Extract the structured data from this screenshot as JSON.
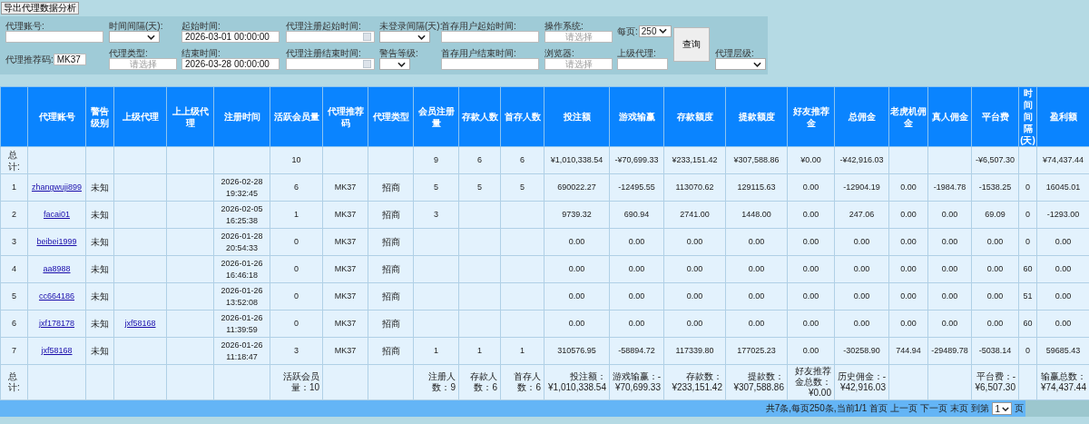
{
  "export_button": "导出代理数据分析",
  "filter_rows": [
    [
      {
        "label": "代理账号:",
        "kind": "text",
        "label_inline": false
      },
      {
        "label": "时间间隔(天):",
        "kind": "select",
        "label_inline": false
      },
      {
        "label": "起始时间:",
        "kind": "text",
        "value": "2026-03-01 00:00:00",
        "label_inline": false
      },
      {
        "label": "代理注册起始时间:",
        "kind": "date",
        "label_inline": false
      },
      {
        "label": "未登录间隔(天):",
        "kind": "select",
        "label_inline": false
      },
      {
        "label": "首存用户起始时间:",
        "kind": "text",
        "label_inline": false
      },
      {
        "label": "操作系统:",
        "kind": "text",
        "placeholder": "请选择",
        "label_inline": false
      },
      {
        "label": "每页:",
        "kind": "select",
        "value": "250",
        "label_inline": true
      }
    ],
    [
      {
        "label": "代理推荐码:",
        "kind": "text",
        "value": "MK37",
        "label_inline": true
      },
      {
        "label": "代理类型:",
        "kind": "text",
        "placeholder": "请选择",
        "label_inline": false
      },
      {
        "label": "结束时间:",
        "kind": "text",
        "value": "2026-03-28 00:00:00",
        "label_inline": false
      },
      {
        "label": "代理注册结束时间:",
        "kind": "date",
        "label_inline": false
      },
      {
        "label": "警告等级:",
        "kind": "select",
        "label_inline": false
      },
      {
        "label": "首存用户结束时间:",
        "kind": "text",
        "label_inline": false
      },
      {
        "label": "浏览器:",
        "kind": "text",
        "placeholder": "请选择",
        "label_inline": false
      },
      {
        "label": "上级代理:",
        "kind": "text",
        "label_inline": false
      },
      {
        "label": "代理层级:",
        "kind": "select",
        "label_inline": false
      }
    ]
  ],
  "query_button": "查询",
  "table": {
    "columns": [
      "代理账号",
      "警告级别",
      "上级代理",
      "上上级代理",
      "注册时间",
      "活跃会员量",
      "代理推荐码",
      "代理类型",
      "会员注册量",
      "存款人数",
      "首存人数",
      "投注额",
      "游戏输赢",
      "存款额度",
      "提款额度",
      "好友推荐金",
      "总佣金",
      "老虎机佣金",
      "真人佣金",
      "平台费",
      "时间间隔(天)",
      "盈利额"
    ],
    "total_top": {
      "label": "总计:",
      "active_members": "10",
      "member_registrations": "9",
      "depositors": "6",
      "first_depositors": "6",
      "bet": "¥1,010,338.54",
      "game_win_loss": "-¥70,699.33",
      "deposits": "¥233,151.42",
      "withdrawals": "¥307,588.86",
      "referral_bonus": "¥0.00",
      "commission": "-¥42,916.03",
      "platform_fee": "-¥6,507.30",
      "profit": "¥74,437.44"
    },
    "rows": [
      {
        "no": "1",
        "account": "zhangwuji899",
        "warning_level": "未知",
        "registered": "2026-02-28 19:32:45",
        "active_members": "6",
        "referral_code": "MK37",
        "agent_type": "招商",
        "member_registrations": "5",
        "depositors": "5",
        "first_depositors": "5",
        "bet": "690022.27",
        "game_win_loss": "-12495.55",
        "deposits": "113070.62",
        "withdrawals": "129115.63",
        "referral_bonus": "0.00",
        "commission": "-12904.19",
        "slot_commission": "0.00",
        "live_commission": "-1984.78",
        "platform_fee": "-1538.25",
        "interval_days": "0",
        "profit": "16045.01"
      },
      {
        "no": "2",
        "account": "facai01",
        "warning_level": "未知",
        "registered": "2026-02-05 16:25:38",
        "active_members": "1",
        "referral_code": "MK37",
        "agent_type": "招商",
        "member_registrations": "3",
        "bet": "9739.32",
        "game_win_loss": "690.94",
        "deposits": "2741.00",
        "withdrawals": "1448.00",
        "referral_bonus": "0.00",
        "commission": "247.06",
        "slot_commission": "0.00",
        "live_commission": "0.00",
        "platform_fee": "69.09",
        "interval_days": "0",
        "profit": "-1293.00"
      },
      {
        "no": "3",
        "account": "beibei1999",
        "warning_level": "未知",
        "registered": "2026-01-28 20:54:33",
        "active_members": "0",
        "referral_code": "MK37",
        "agent_type": "招商",
        "bet": "0.00",
        "game_win_loss": "0.00",
        "deposits": "0.00",
        "withdrawals": "0.00",
        "referral_bonus": "0.00",
        "commission": "0.00",
        "slot_commission": "0.00",
        "live_commission": "0.00",
        "platform_fee": "0.00",
        "interval_days": "0",
        "profit": "0.00"
      },
      {
        "no": "4",
        "account": "aa8988",
        "warning_level": "未知",
        "registered": "2026-01-26 16:46:18",
        "active_members": "0",
        "referral_code": "MK37",
        "agent_type": "招商",
        "bet": "0.00",
        "game_win_loss": "0.00",
        "deposits": "0.00",
        "withdrawals": "0.00",
        "referral_bonus": "0.00",
        "commission": "0.00",
        "slot_commission": "0.00",
        "live_commission": "0.00",
        "platform_fee": "0.00",
        "interval_days": "60",
        "profit": "0.00"
      },
      {
        "no": "5",
        "account": "cc664186",
        "warning_level": "未知",
        "registered": "2026-01-26 13:52:08",
        "active_members": "0",
        "referral_code": "MK37",
        "agent_type": "招商",
        "bet": "0.00",
        "game_win_loss": "0.00",
        "deposits": "0.00",
        "withdrawals": "0.00",
        "referral_bonus": "0.00",
        "commission": "0.00",
        "slot_commission": "0.00",
        "live_commission": "0.00",
        "platform_fee": "0.00",
        "interval_days": "51",
        "profit": "0.00"
      },
      {
        "no": "6",
        "account": "jxf178178",
        "warning_level": "未知",
        "parent_agent": "jxf58168",
        "registered": "2026-01-26 11:39:59",
        "active_members": "0",
        "referral_code": "MK37",
        "agent_type": "招商",
        "bet": "0.00",
        "game_win_loss": "0.00",
        "deposits": "0.00",
        "withdrawals": "0.00",
        "referral_bonus": "0.00",
        "commission": "0.00",
        "slot_commission": "0.00",
        "live_commission": "0.00",
        "platform_fee": "0.00",
        "interval_days": "60",
        "profit": "0.00"
      },
      {
        "no": "7",
        "account": "jxf58168",
        "warning_level": "未知",
        "registered": "2026-01-26 11:18:47",
        "active_members": "3",
        "referral_code": "MK37",
        "agent_type": "招商",
        "member_registrations": "1",
        "depositors": "1",
        "first_depositors": "1",
        "bet": "310576.95",
        "game_win_loss": "-58894.72",
        "deposits": "117339.80",
        "withdrawals": "177025.23",
        "referral_bonus": "0.00",
        "commission": "-30258.90",
        "slot_commission": "744.94",
        "live_commission": "-29489.78",
        "platform_fee": "-5038.14",
        "interval_days": "0",
        "profit": "59685.43"
      }
    ],
    "total_bottom": {
      "label": "总计:",
      "active_members": "活跃会员量：10",
      "member_registrations": "注册人数：9",
      "depositors": "存款人数：6",
      "first_depositors": "首存人数：6",
      "bet": "投注额：¥1,010,338.54",
      "game_win_loss": "游戏输赢：-¥70,699.33",
      "deposits": "存款数：¥233,151.42",
      "withdrawals": "提款数：¥307,588.86",
      "referral_bonus": "好友推荐金总数：¥0.00",
      "commission": "历史佣金：-¥42,916.03",
      "platform_fee": "平台费：-¥6,507.30",
      "profit": "输赢总数：¥74,437.44"
    }
  },
  "pager": {
    "summary": "共7条,每页250条,当前1/1",
    "links": [
      "首页",
      "上一页",
      "下一页",
      "末页"
    ],
    "goto_label": "到第",
    "page": "1",
    "page_suffix": "页"
  }
}
